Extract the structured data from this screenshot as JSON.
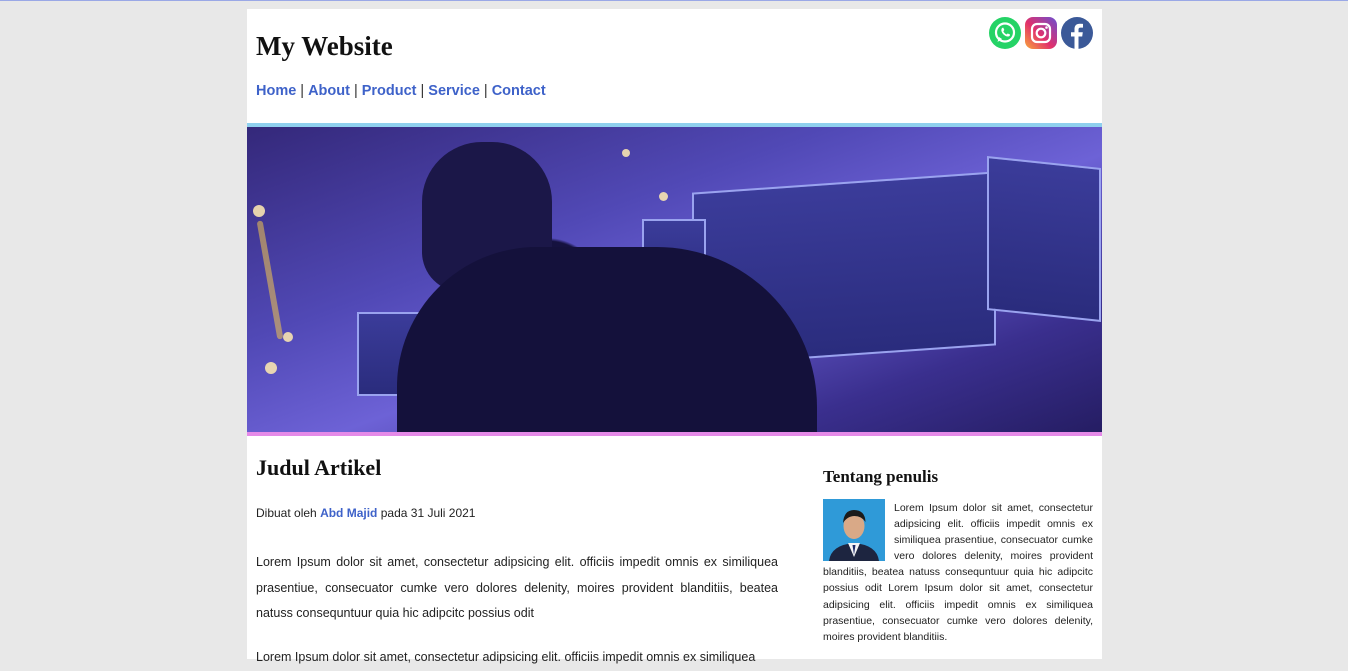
{
  "site": {
    "title": "My Website"
  },
  "nav": {
    "items": [
      {
        "label": "Home"
      },
      {
        "label": "About"
      },
      {
        "label": "Product"
      },
      {
        "label": "Service"
      },
      {
        "label": "Contact"
      }
    ],
    "separator": "|"
  },
  "social": {
    "icons": [
      "whatsapp-icon",
      "instagram-icon",
      "facebook-icon"
    ],
    "colors": {
      "whatsapp": "#25d366",
      "instagram": "#c13584",
      "facebook": "#3b5998"
    }
  },
  "article": {
    "title": "Judul Artikel",
    "byline_prefix": "Dibuat oleh",
    "author": "Abd Majid",
    "byline_suffix": "pada 31 Juli 2021",
    "paragraphs": [
      "Lorem Ipsum dolor sit amet, consectetur adipsicing elit. officiis impedit omnis ex similiquea prasentiue, consecuator cumke vero dolores delenity, moires provident blanditiis, beatea natuss consequntuur quia hic adipcitc possius odit",
      "Lorem Ipsum dolor sit amet, consectetur adipsicing elit. officiis impedit omnis ex similiquea"
    ]
  },
  "aside": {
    "heading": "Tentang penulis",
    "text": "Lorem Ipsum dolor sit amet, consectetur adipsicing elit. officiis impedit omnis ex similiquea prasentiue, consecuator cumke vero dolores delenity, moires provident blanditiis, beatea natuss consequntuur quia hic adipcitc possius odit Lorem Ipsum dolor sit amet, consectetur adipsicing elit. officiis impedit omnis ex similiquea prasentiue, consecuator cumke vero dolores delenity, moires provident blanditiis."
  },
  "colors": {
    "link": "#3e62c9",
    "hero_top_border": "#8fd0ee",
    "hero_bottom_border": "#e58ae8"
  }
}
